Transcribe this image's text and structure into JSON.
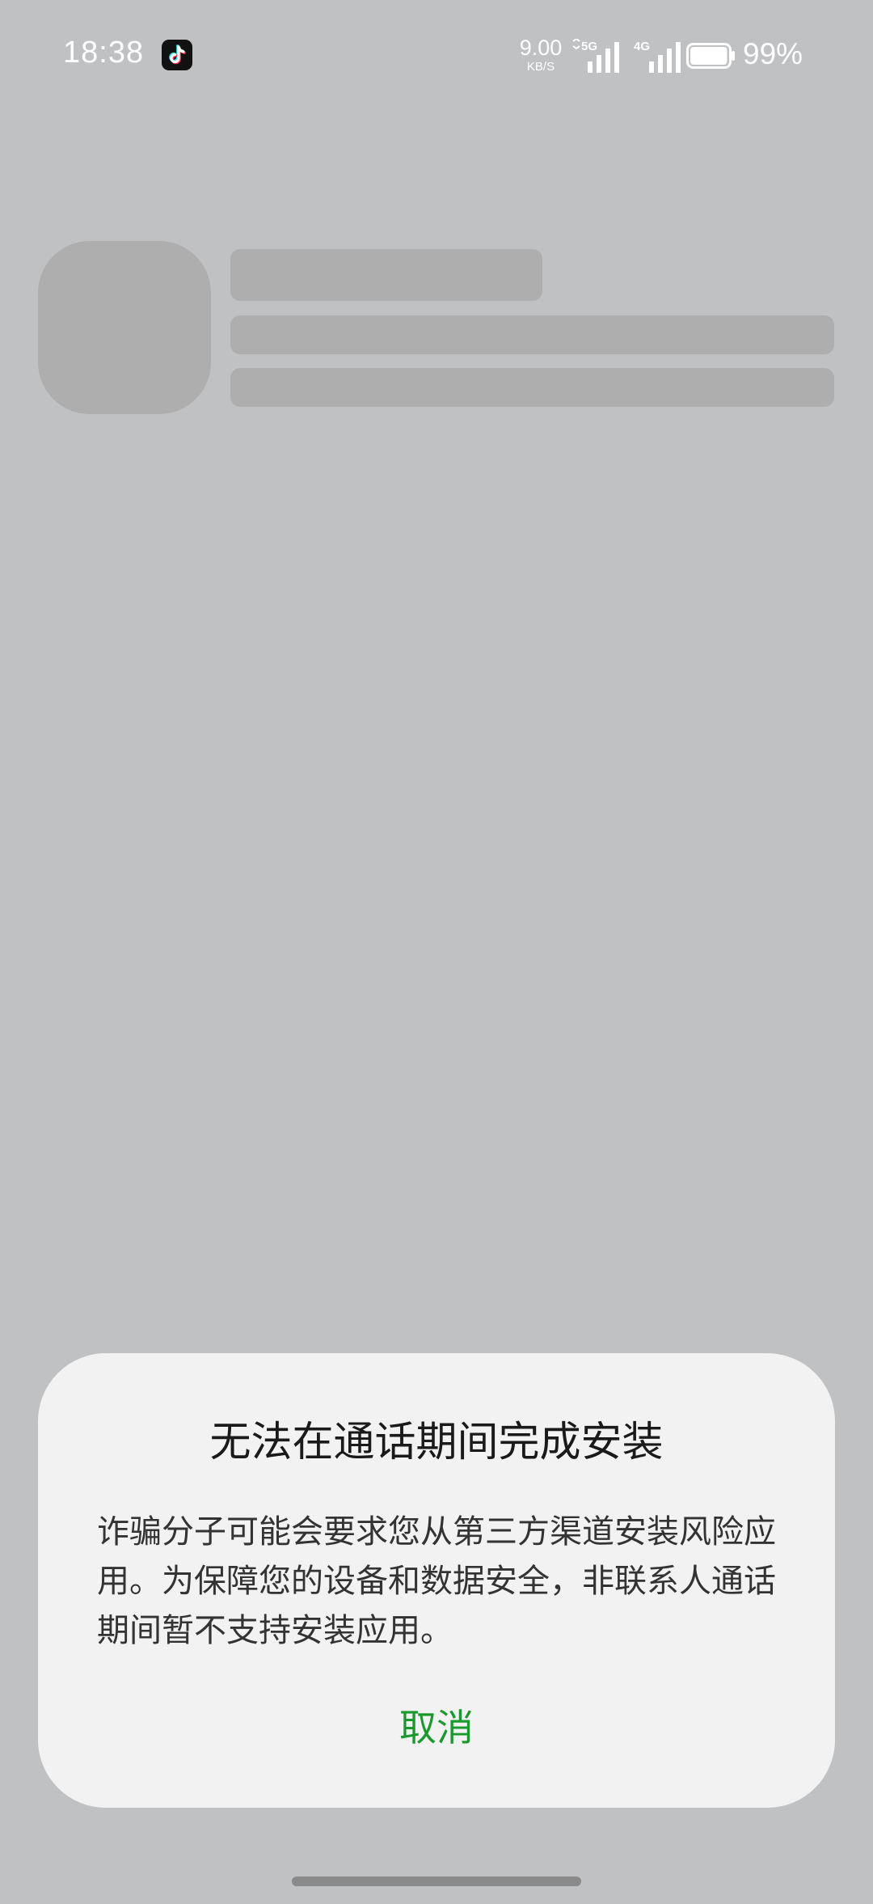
{
  "status_bar": {
    "time": "18:38",
    "notification_icon": "tiktok-icon",
    "net_speed_value": "9.00",
    "net_speed_unit": "KB/S",
    "signal_1_label": "5G",
    "signal_2_label": "4G",
    "battery": "99%",
    "battery_level": 0.99
  },
  "dialog": {
    "title": "无法在通话期间完成安装",
    "message": "诈骗分子可能会要求您从第三方渠道安装风险应用。为保障您的设备和数据安全，非联系人通话期间暂不支持安装应用。",
    "cancel_label": "取消"
  },
  "colors": {
    "background": "#c0c1c3",
    "dialog": "#f2f2f2",
    "accent": "#1a9a2e",
    "skeleton": "#aeaeae"
  }
}
